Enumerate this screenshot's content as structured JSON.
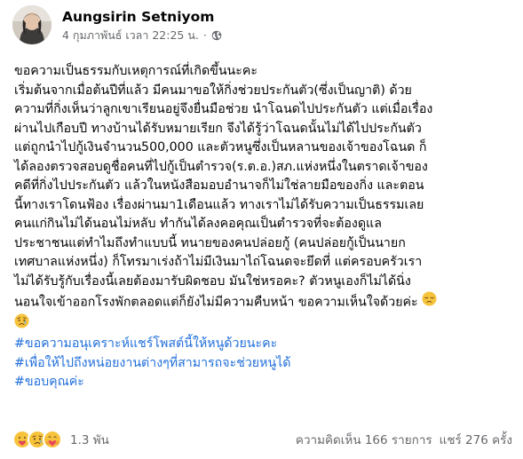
{
  "post": {
    "author": "Aungsirin Setniyom",
    "timestamp": "4 กุมภาพันธ์ เวลา 22:25 น.",
    "separator": "·",
    "privacy_icon": "globe-icon",
    "lines": [
      "ขอความเป็นธรรมกับเหตุการณ์ที่เกิดขึ้นนะคะ",
      "เริ่มต้นจากเมื่อต้นปีที่แล้ว มีคนมาขอให้กิ่งช่วยประกันตัว(ซึ่งเป็นญาติ) ด้วย",
      "ความที่กิ่งเห็นว่าลูกเขาเรียนอยู่จึงยื่นมือช่วย นำโฉนดไปประกันตัว แต่เมื่อเรื่อง",
      "ผ่านไปเกือบปี ทางบ้านได้รับหมายเรียก จึงได้รู้ว่าโฉนดนั้นไม่ได้ไปประกันตัว",
      "แต่ถูกนำไปกู้เงินจำนวน500,000 และตัวหนูซึ่งเป็นหลานของเจ้าของโฉนด ก็",
      "ได้ลองตรวจสอบดูชื่อคนที่ไปกู้เป็นตำรวจ(ร.ต.อ.)สภ.แห่งหนึ่งในตราดเจ้าของ",
      "คดีที่กิ่งไปประกันตัว แล้วในหนังสือมอบอำนาจก็ไม่ใช่ลายมือของกิ่ง และตอน",
      "นี้ทางเราโดนฟ้อง เรื่องผ่านมา1เดือนแล้ว ทางเราไม่ได้รับความเป็นธรรมเลย",
      "คนแก่กินไม่ได้นอนไม่หลับ ทำกันได้ลงคอคุณเป็นตำรวจที่จะต้องดูแล",
      "ประชาชนแต่ทำไมถึงทำแบบนี้ ทนายของคนปล่อยกู้ (คนปล่อยกู้เป็นนายก",
      "เทศบาลแห่งหนึ่ง) ก็โทรมาเร่งถ้าไม่มีเงินมาไถ่โฉนดจะยึดที่ แต่ครอบครัวเรา",
      "ไม่ได้รับรู้กับเรื่องนี้เลยต้องมารับผิดชอบ มันใช่หรอคะ? ตัวหนูเองก็ไม่ได้นิ่ง",
      "นอนใจเข้าออกโรงพักตลอดแต่ก็ยังไม่มีความคืบหน้า ขอความเห็นใจด้วยค่ะ"
    ],
    "inline_emojis": [
      "pensive-face",
      "sad-but-relieved-face"
    ],
    "hashtags": [
      "#ขอความอนุเคราะห์แชร์โพสต์นี้ให้หนูด้วยนะคะ",
      "#เพื่อให้ไปถึงหน่อยงานต่างๆที่สามารถจะช่วยหนูได้",
      "#ขอบคุณค่ะ"
    ]
  },
  "footer": {
    "reactions": [
      "care",
      "sad",
      "care-hug"
    ],
    "reaction_count": "1.3 พัน",
    "comments": "ความคิดเห็น 166 รายการ",
    "shares": "แชร์ 276 ครั้ง"
  },
  "colors": {
    "text": "#050505",
    "secondary": "#65676b",
    "hashtag": "#216fdb",
    "emoji_yellow": "#f7c33c"
  }
}
